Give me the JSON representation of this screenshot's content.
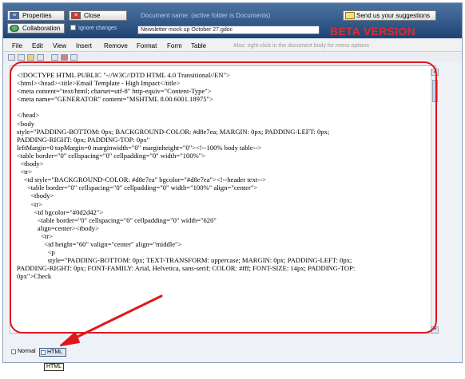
{
  "header": {
    "properties_label": "Properties",
    "close_label": "Close",
    "collaboration_label": "Collaboration",
    "ignore_changes_label": "Ignore changes",
    "docname_label": "Document name: (active folder is Documents)",
    "docname_value": "Newsletter mock up October 27.gdoc",
    "suggest_label": "Send us your suggestions",
    "beta_label": "BETA VERSION"
  },
  "menu": {
    "items": [
      "File",
      "Edit",
      "View",
      "Insert",
      "Remove",
      "Format",
      "Form",
      "Table"
    ],
    "hint": "Also: right-click in the document body for menu options"
  },
  "editor": {
    "lines": [
      "<!DOCTYPE HTML PUBLIC \"-//W3C//DTD HTML 4.0 Transitional//EN\">",
      "<html><head><title>Email Template - High Impact</title>",
      "<meta content=\"text/html; charset=utf-8\" http-equiv=\"Content-Type\">",
      "<meta name=\"GENERATOR\" content=\"MSHTML 8.00.6001.18975\">",
      "",
      "</head>",
      "<body",
      "style=\"PADDING-BOTTOM: 0px; BACKGROUND-COLOR: #d8e7ea; MARGIN: 0px; PADDING-LEFT: 0px;",
      "PADDING-RIGHT: 0px; PADDING-TOP: 0px\"",
      "leftMargin=0 topMargin=0 marginwidth=\"0\" marginheight=\"0\"><!--100% body table-->",
      "<table border=\"0\" cellspacing=\"0\" cellpadding=\"0\" width=\"100%\">",
      "  <tbody>",
      "  <tr>",
      "    <td style=\"BACKGROUND-COLOR: #d8e7ea\" bgcolor=\"#d8e7ea\"><!--header text-->",
      "      <table border=\"0\" cellspacing=\"0\" cellpadding=\"0\" width=\"100%\" align=\"center\">",
      "        <tbody>",
      "        <tr>",
      "          <td bgcolor=\"#0d2d42\">",
      "            <table border=\"0\" cellspacing=\"0\" cellpadding=\"0\" width=\"620\"",
      "            align=center><tbody>",
      "              <tr>",
      "                <td height=\"60\" valign=\"center\" align=\"middle\">",
      "                  <p",
      "                  style=\"PADDING-BOTTOM: 0px; TEXT-TRANSFORM: uppercase; MARGIN: 0px; PADDING-LEFT: 0px;",
      "PADDING-RIGHT: 0px; FONT-FAMILY: Arial, Helvetica, sans-serif; COLOR: #fff; FONT-SIZE: 14px; PADDING-TOP:",
      "0px\">Check"
    ]
  },
  "view_tabs": {
    "normal_label": "Normal",
    "html_label": "HTML",
    "tooltip": "HTML"
  },
  "colors": {
    "highlight": "#e0161b",
    "beta": "#e82828",
    "header_top": "#4c74a3",
    "header_bottom": "#1f4474"
  }
}
